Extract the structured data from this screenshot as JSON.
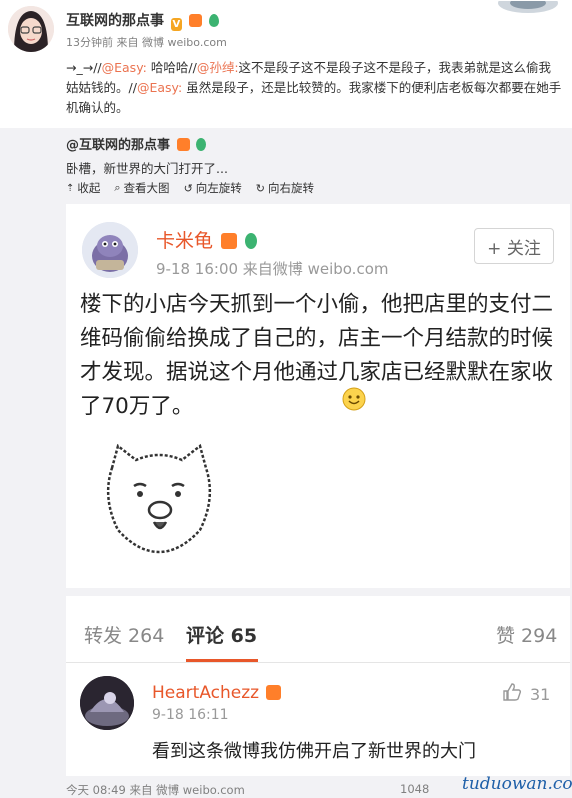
{
  "post": {
    "author": "互联网的那点事",
    "meta": "13分钟前 来自 微博 weibo.com",
    "text_prefix": "→_→//",
    "mention1": "@Easy:",
    "text1": " 哈哈哈//",
    "mention2": "@孙绰:",
    "text2": "这不是段子这不是段子这不是段子，我表弟就是这么偷我姑姑钱的。//",
    "mention3": "@Easy:",
    "text3": " 虽然是段子，还是比较赞的。我家楼下的便利店老板每次都要在她手机确认的。"
  },
  "repost": {
    "author": "@互联网的那点事",
    "text": "卧槽，新世界的大门打开了...",
    "toolbar": {
      "collapse": "收起",
      "view_large": "查看大图",
      "rotate_left": "向左旋转",
      "rotate_right": "向右旋转"
    }
  },
  "card": {
    "user": "卡米龟",
    "meta": "9-18 16:00  来自微博 weibo.com",
    "follow": "+ 关注",
    "text": "楼下的小店今天抓到一个小偷，他把店里的支付二维码偷偷给换成了自己的，店主一个月结款的时候才发现。据说这个月他通过几家店已经默默在家收了70万了。"
  },
  "stats": {
    "repost": "转发 264",
    "comment": "评论 65",
    "like": "赞 294"
  },
  "comment": {
    "user": "HeartAchezz",
    "time": "9-18 16:11",
    "likes": "31",
    "text": "看到这条微博我仿佛开启了新世界的大门"
  },
  "footer": {
    "meta": "今天 08:49 来自 微博 weibo.com",
    "count": "1048"
  },
  "watermark": "tuduowan.com",
  "colors": {
    "link": "#eb7350",
    "accent": "#e8572a"
  }
}
